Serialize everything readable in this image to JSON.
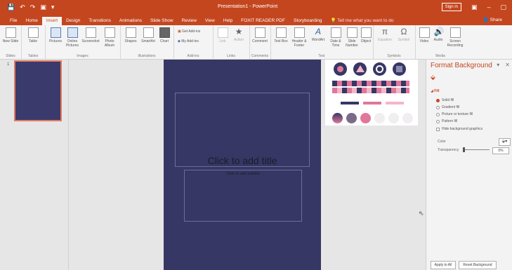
{
  "titlebar": {
    "quick_access": [
      "💾",
      "↶",
      "↷",
      "▣",
      "▾"
    ],
    "doc_title": "Presentation1 - PowerPoint",
    "sign_in": "Sign in",
    "window_buttons": [
      "▣",
      "–",
      "▢",
      "✕"
    ]
  },
  "tabs": [
    "File",
    "Home",
    "Insert",
    "Design",
    "Transitions",
    "Animations",
    "Slide Show",
    "Review",
    "View",
    "Help",
    "FOXIT READER PDF",
    "Storyboarding"
  ],
  "tell_me": "Tell me what you want to do",
  "share": "Share",
  "ribbon": {
    "groups": [
      "Slides",
      "Tables",
      "Images",
      "Illustrations",
      "Add-ins",
      "Links",
      "Comments",
      "Text",
      "Symbols",
      "Media"
    ],
    "buttons": {
      "new_slide": "New Slide",
      "table": "Table",
      "pictures": "Pictures",
      "online_pictures": "Online Pictures",
      "screenshot": "Screenshot",
      "photo_album": "Photo Album",
      "shapes": "Shapes",
      "smartart": "SmartArt",
      "chart": "Chart",
      "get_addins": "Get Add-ins",
      "my_addins": "My Add-ins",
      "link": "Link",
      "action": "Action",
      "comment": "Comment",
      "text_box": "Text Box",
      "header_footer": "Header & Footer",
      "wordart": "WordArt",
      "date_time": "Date & Time",
      "slide_number": "Slide Number",
      "object": "Object",
      "equation": "Equation",
      "symbol": "Symbol",
      "video": "Video",
      "audio": "Audio",
      "screen_recording": "Screen Recording"
    }
  },
  "slides_panel": {
    "slide_number": "1"
  },
  "slide": {
    "title_placeholder": "Click to add title",
    "subtitle_placeholder": "Click to add subtitle"
  },
  "format_pane": {
    "title": "Format Background",
    "section": "Fill",
    "options": [
      "Solid fill",
      "Gradient fill",
      "Picture or texture fill",
      "Pattern fill"
    ],
    "hide_graphics": "Hide background graphics",
    "color_label": "Color",
    "transparency_label": "Transparency",
    "transparency_value": "0%",
    "apply_all": "Apply to All",
    "reset": "Reset Background"
  },
  "colors": {
    "accent": "#c4461f",
    "slide_bg": "#363764",
    "pink": "#e0779a",
    "light_pink": "#f4b6c8"
  }
}
